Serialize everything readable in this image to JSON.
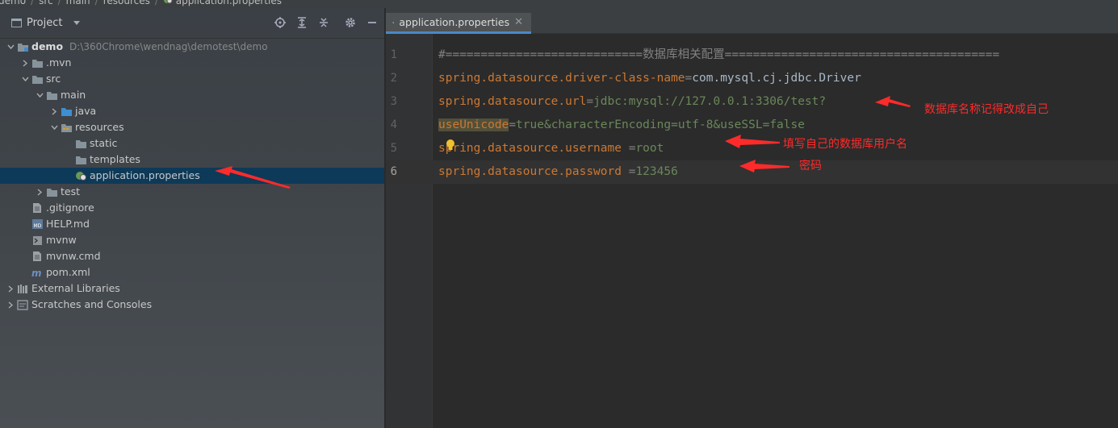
{
  "breadcrumb": [
    "demo",
    "src",
    "main",
    "resources",
    "application.properties"
  ],
  "project_panel": {
    "title": "Project",
    "tree": [
      {
        "label": "demo",
        "hint": "D:\\360Chrome\\wendnag\\demotest\\demo",
        "depth": 0,
        "arrow": "down",
        "icon": "module-folder-icon",
        "bold": true
      },
      {
        "label": ".mvn",
        "depth": 1,
        "arrow": "right",
        "icon": "folder-icon"
      },
      {
        "label": "src",
        "depth": 1,
        "arrow": "down",
        "icon": "folder-icon"
      },
      {
        "label": "main",
        "depth": 2,
        "arrow": "down",
        "icon": "folder-icon"
      },
      {
        "label": "java",
        "depth": 3,
        "arrow": "right",
        "icon": "source-folder-icon"
      },
      {
        "label": "resources",
        "depth": 3,
        "arrow": "down",
        "icon": "resources-folder-icon"
      },
      {
        "label": "static",
        "depth": 4,
        "arrow": "",
        "icon": "folder-icon"
      },
      {
        "label": "templates",
        "depth": 4,
        "arrow": "",
        "icon": "folder-icon"
      },
      {
        "label": "application.properties",
        "depth": 4,
        "arrow": "",
        "icon": "spring-properties-icon",
        "selected": true
      },
      {
        "label": "test",
        "depth": 2,
        "arrow": "right",
        "icon": "folder-icon"
      },
      {
        "label": ".gitignore",
        "depth": 1,
        "arrow": "",
        "icon": "file-icon"
      },
      {
        "label": "HELP.md",
        "depth": 1,
        "arrow": "",
        "icon": "markdown-icon"
      },
      {
        "label": "mvnw",
        "depth": 1,
        "arrow": "",
        "icon": "shell-file-icon"
      },
      {
        "label": "mvnw.cmd",
        "depth": 1,
        "arrow": "",
        "icon": "file-icon"
      },
      {
        "label": "pom.xml",
        "depth": 1,
        "arrow": "",
        "icon": "maven-icon"
      },
      {
        "label": "External Libraries",
        "depth": 0,
        "arrow": "right",
        "icon": "libraries-icon"
      },
      {
        "label": "Scratches and Consoles",
        "depth": 0,
        "arrow": "right",
        "icon": "scratches-icon"
      }
    ]
  },
  "editor": {
    "tab_label": "application.properties",
    "lines": [
      {
        "num": "1",
        "comment": "#============================数据库相关配置======================================="
      },
      {
        "num": "2",
        "key": "spring.datasource.driver-class-name",
        "eq": "=",
        "value": "com.mysql.cj.jdbc.Driver"
      },
      {
        "num": "3",
        "key": "spring.datasource.url",
        "eq": "=",
        "value": "jdbc:mysql://127.0.0.1:3306/test?"
      },
      {
        "num": "4",
        "key": "useUnicode",
        "eq": "=",
        "value": "true&characterEncoding=utf-8&useSSL=false"
      },
      {
        "num": "5",
        "key": "spring.datasource.username ",
        "eq": "=",
        "value": "root"
      },
      {
        "num": "6",
        "key": "spring.datasource.password ",
        "eq": "=",
        "value": "123456"
      }
    ]
  },
  "annotations": {
    "db_name": "数据库名称记得改成自己",
    "username": "填写自己的数据库用户名",
    "password": "密码"
  },
  "colors": {
    "accent_red": "#ff2a2a",
    "selection": "#0d3a58",
    "key": "#cc7832",
    "value": "#6a8759"
  }
}
